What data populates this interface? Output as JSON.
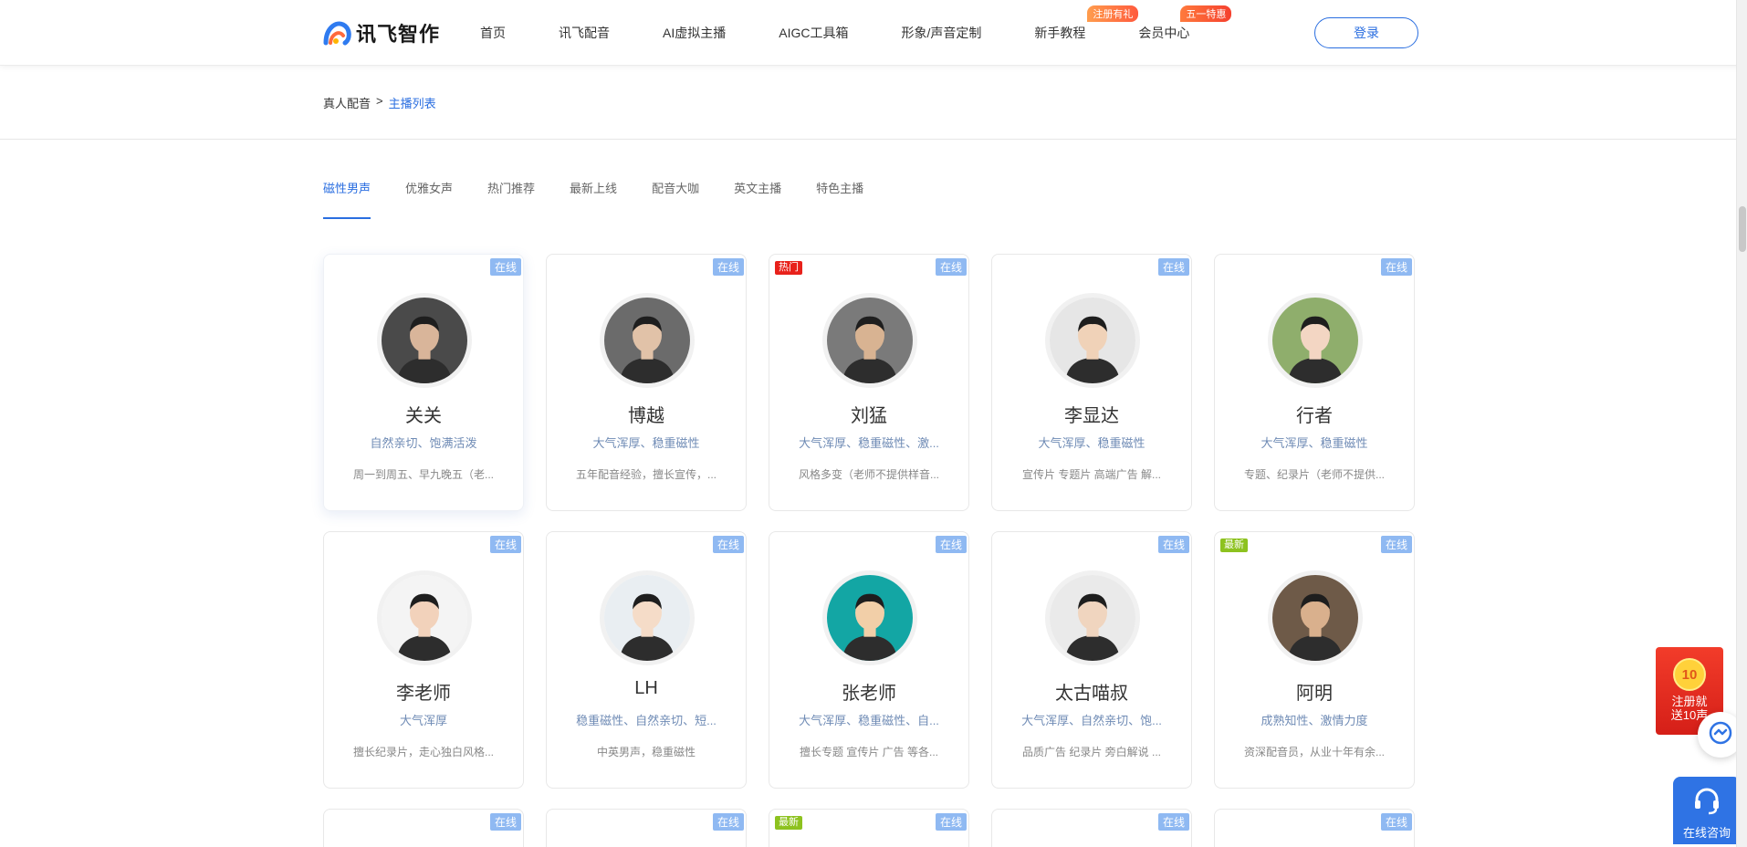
{
  "header": {
    "logo_text": "讯飞智作",
    "nav": [
      {
        "label": "首页",
        "badge": ""
      },
      {
        "label": "讯飞配音",
        "badge": ""
      },
      {
        "label": "AI虚拟主播",
        "badge": ""
      },
      {
        "label": "AIGC工具箱",
        "badge": ""
      },
      {
        "label": "形象/声音定制",
        "badge": ""
      },
      {
        "label": "新手教程",
        "badge": "注册有礼"
      },
      {
        "label": "会员中心",
        "badge": "五一特惠"
      }
    ],
    "login_label": "登录"
  },
  "breadcrumb": {
    "root": "真人配音",
    "separator": ">",
    "current": "主播列表"
  },
  "tabs": [
    "磁性男声",
    "优雅女声",
    "热门推荐",
    "最新上线",
    "配音大咖",
    "英文主播",
    "特色主播"
  ],
  "online_label": "在线",
  "cards": [
    {
      "name": "关关",
      "styles": "自然亲切、饱满活泼",
      "desc": "周一到周五、早九晚五（老...",
      "left_tag": "",
      "avatar_bg": "#4a4a4a",
      "avatar_skin": "#d9b59a"
    },
    {
      "name": "博越",
      "styles": "大气浑厚、稳重磁性",
      "desc": "五年配音经验，擅长宣传，...",
      "left_tag": "",
      "avatar_bg": "#6b6b6b",
      "avatar_skin": "#e1c2a8"
    },
    {
      "name": "刘猛",
      "styles": "大气浑厚、稳重磁性、激...",
      "desc": "风格多变（老师不提供样音...",
      "left_tag": "热门",
      "avatar_bg": "#7a7a7a",
      "avatar_skin": "#d8b392"
    },
    {
      "name": "李显达",
      "styles": "大气浑厚、稳重磁性",
      "desc": "宣传片 专题片 高端广告 解...",
      "left_tag": "",
      "avatar_bg": "#e6e6e6",
      "avatar_skin": "#f0d2b8"
    },
    {
      "name": "行者",
      "styles": "大气浑厚、稳重磁性",
      "desc": "专题、纪录片（老师不提供...",
      "left_tag": "",
      "avatar_bg": "#8fae6c",
      "avatar_skin": "#f3d6c3"
    },
    {
      "name": "李老师",
      "styles": "大气浑厚",
      "desc": "擅长纪录片，走心独白风格...",
      "left_tag": "",
      "avatar_bg": "#f4f4f4",
      "avatar_skin": "#f2d2bb"
    },
    {
      "name": "LH",
      "styles": "稳重磁性、自然亲切、短...",
      "desc": "中英男声，稳重磁性",
      "left_tag": "",
      "avatar_bg": "#e9eef2",
      "avatar_skin": "#f5dcc8"
    },
    {
      "name": "张老师",
      "styles": "大气浑厚、稳重磁性、自...",
      "desc": "擅长专题 宣传片 广告 等各...",
      "left_tag": "",
      "avatar_bg": "#13a6a4",
      "avatar_skin": "#f2cfa8"
    },
    {
      "name": "太古喵叔",
      "styles": "大气浑厚、自然亲切、饱...",
      "desc": "品质广告 纪录片 旁白解说 ...",
      "left_tag": "",
      "avatar_bg": "#eaeaea",
      "avatar_skin": "#f0d5bf"
    },
    {
      "name": "阿明",
      "styles": "成熟知性、激情力度",
      "desc": "资深配音员，从业十年有余...",
      "left_tag": "最新",
      "avatar_bg": "#6e5a48",
      "avatar_skin": "#d9b08d"
    }
  ],
  "partial_cards": [
    {
      "left_tag": ""
    },
    {
      "left_tag": ""
    },
    {
      "left_tag": "最新"
    },
    {
      "left_tag": ""
    },
    {
      "left_tag": ""
    }
  ],
  "float": {
    "coin": "10",
    "redpack_line1": "注册就",
    "redpack_line2": "送10声",
    "consult_label": "在线咨询"
  },
  "colors": {
    "accent": "#2a6ee0",
    "online_tag": "#8fb9f2",
    "hot_tag": "#e8211b",
    "new_tag": "#8dc21f"
  }
}
